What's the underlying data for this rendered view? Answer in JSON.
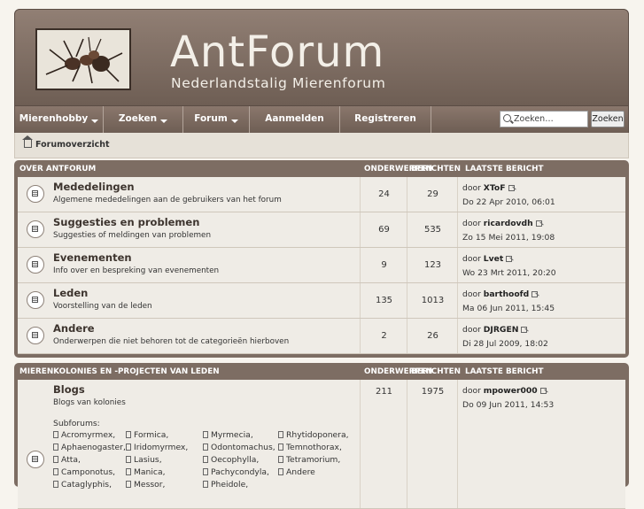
{
  "site": {
    "title": "AntForum",
    "subtitle": "Nederlandstalig Mierenforum"
  },
  "nav": {
    "items": [
      {
        "label": "Mierenhobby",
        "dropdown": true
      },
      {
        "label": "Zoeken",
        "dropdown": true
      },
      {
        "label": "Forum",
        "dropdown": true
      },
      {
        "label": "Aanmelden",
        "dropdown": false
      },
      {
        "label": "Registreren",
        "dropdown": false
      }
    ],
    "search_placeholder": "Zoeken…",
    "search_button": "Zoeken"
  },
  "breadcrumb": {
    "label": "Forumoverzicht"
  },
  "sections": [
    {
      "title": "OVER ANTFORUM",
      "col_topics": "ONDERWERPEN",
      "col_posts": "BERICHTEN",
      "col_last": "LAATSTE BERICHT",
      "forums": [
        {
          "title": "Mededelingen",
          "desc": "Algemene mededelingen aan de gebruikers van het forum",
          "topics": "24",
          "posts": "29",
          "by_prefix": "door",
          "last_user": "XToF",
          "last_date": "Do 22 Apr 2010, 06:01"
        },
        {
          "title": "Suggesties en problemen",
          "desc": "Suggesties of meldingen van problemen",
          "topics": "69",
          "posts": "535",
          "by_prefix": "door",
          "last_user": "ricardovdh",
          "last_date": "Zo 15 Mei 2011, 19:08"
        },
        {
          "title": "Evenementen",
          "desc": "Info over en bespreking van evenementen",
          "topics": "9",
          "posts": "123",
          "by_prefix": "door",
          "last_user": "Lvet",
          "last_date": "Wo 23 Mrt 2011, 20:20"
        },
        {
          "title": "Leden",
          "desc": "Voorstelling van de leden",
          "topics": "135",
          "posts": "1013",
          "by_prefix": "door",
          "last_user": "barthoofd",
          "last_date": "Ma 06 Jun 2011, 15:45"
        },
        {
          "title": "Andere",
          "desc": "Onderwerpen die niet behoren tot de categorieën hierboven",
          "topics": "2",
          "posts": "26",
          "by_prefix": "door",
          "last_user": "DJRGEN",
          "last_date": "Di 28 Jul 2009, 18:02"
        }
      ]
    },
    {
      "title": "MIERENKOLONIES EN -PROJECTEN VAN LEDEN",
      "col_topics": "ONDERWERPEN",
      "col_posts": "BERICHTEN",
      "col_last": "LAATSTE BERICHT",
      "forums": [
        {
          "title": "Blogs",
          "desc": "Blogs van kolonies",
          "topics": "211",
          "posts": "1975",
          "by_prefix": "door",
          "last_user": "mpower000",
          "last_date": "Do 09 Jun 2011, 14:53",
          "subforums_label": "Subforums:",
          "subforums": [
            [
              "Acromyrmex,",
              "Aphaenogaster,",
              "Atta,",
              "Camponotus,",
              "Cataglyphis,"
            ],
            [
              "Formica,",
              "Iridomyrmex,",
              "Lasius,",
              "Manica,",
              "Messor,"
            ],
            [
              "Myrmecia,",
              "Odontomachus,",
              "Oecophylla,",
              "Pachycondyla,",
              "Pheidole,"
            ],
            [
              "Rhytidoponera,",
              "Temnothorax,",
              "Tetramorium,",
              "Andere"
            ]
          ]
        }
      ]
    }
  ]
}
